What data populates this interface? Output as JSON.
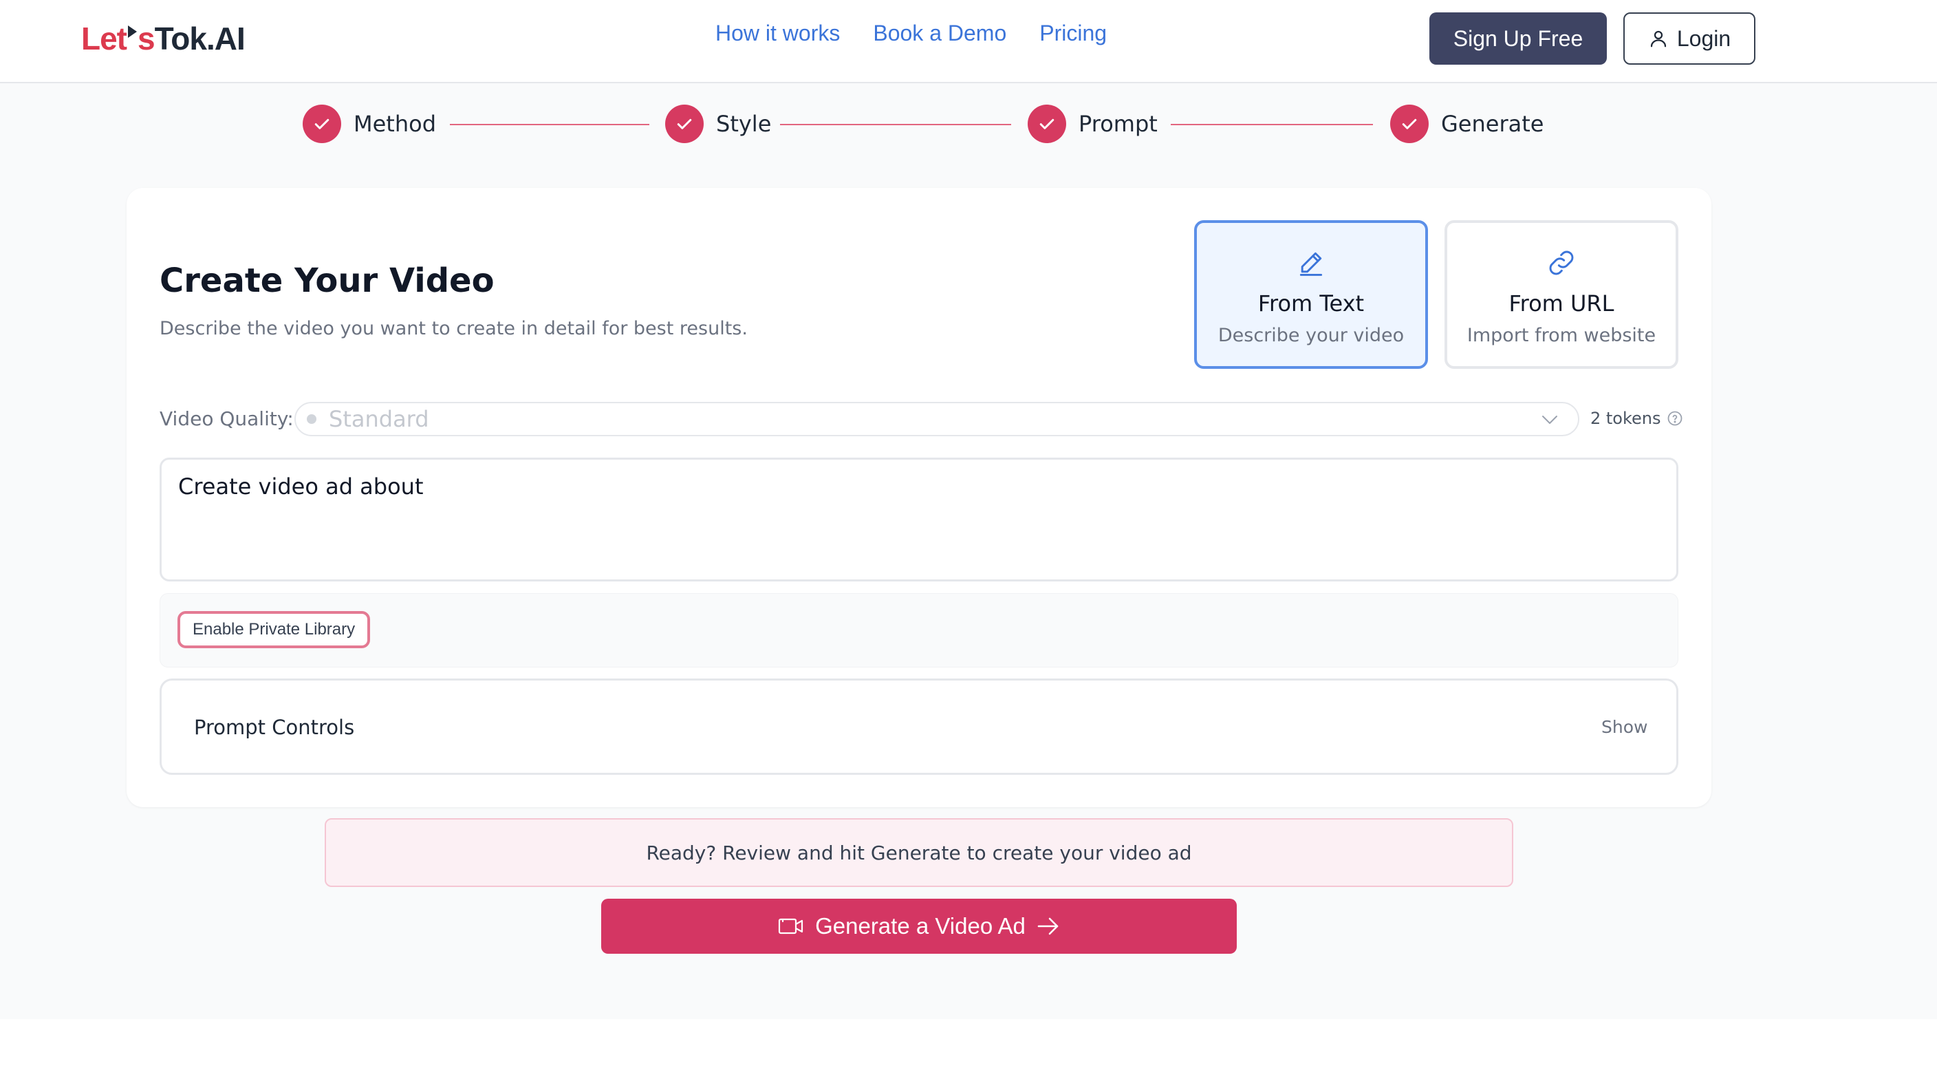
{
  "brand": {
    "logo_part1": "Let",
    "logo_part2": "s",
    "logo_part3": "Tok.AI",
    "accent_color": "#d63a60",
    "link_color": "#3b74d9"
  },
  "nav": {
    "links": [
      "How it works",
      "Book a Demo",
      "Pricing"
    ],
    "signup_label": "Sign Up Free",
    "login_label": "Login"
  },
  "stepper": {
    "steps": [
      {
        "label": "Method",
        "completed": true
      },
      {
        "label": "Style",
        "completed": true
      },
      {
        "label": "Prompt",
        "completed": true
      },
      {
        "label": "Generate",
        "completed": true
      }
    ]
  },
  "main": {
    "title": "Create Your Video",
    "subtitle": "Describe the video you want to create in detail for best results.",
    "methods": [
      {
        "title": "From Text",
        "subtitle": "Describe your video",
        "icon": "pencil-icon",
        "selected": true
      },
      {
        "title": "From URL",
        "subtitle": "Import from website",
        "icon": "link-icon",
        "selected": false
      }
    ],
    "quality": {
      "label": "Video Quality:",
      "value": "Standard",
      "tokens": "2 tokens"
    },
    "prompt_text": "Create video ad about",
    "private_library_label": "Enable Private Library",
    "prompt_controls": {
      "label": "Prompt Controls",
      "toggle": "Show"
    },
    "ready_message": "Ready? Review and hit Generate to create your video ad",
    "generate_label": "Generate a Video Ad"
  }
}
